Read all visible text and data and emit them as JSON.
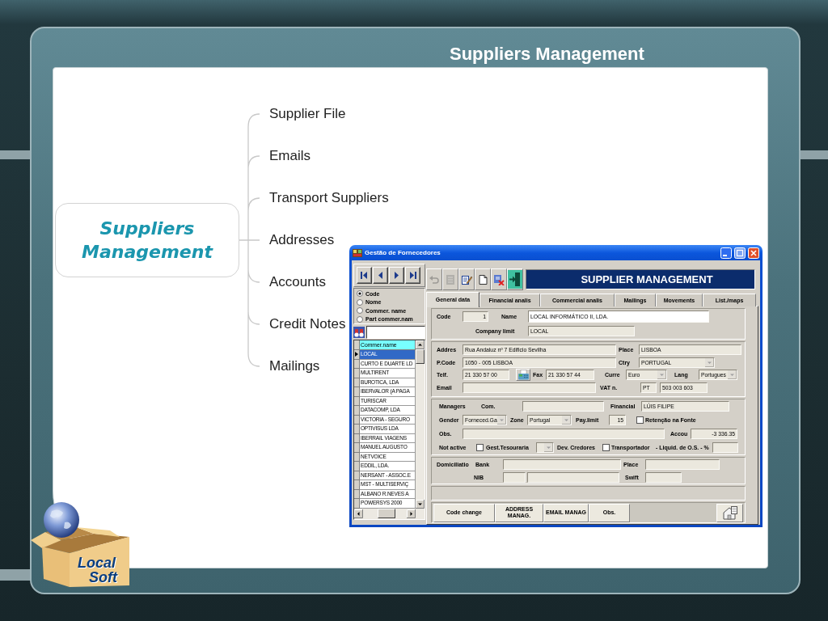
{
  "slide": {
    "title": "Suppliers Management"
  },
  "mind_map": {
    "center": "Suppliers Management",
    "branches": [
      "Supplier File",
      "Emails",
      "Transport Suppliers",
      "Addresses",
      "Accounts",
      "Credit Notes",
      "Mailings"
    ]
  },
  "logo": {
    "lines": [
      "Local",
      "Soft"
    ]
  },
  "window": {
    "title": "Gestão de Fornecedores",
    "search_by": [
      {
        "label": "Code",
        "selected": true
      },
      {
        "label": "Nome",
        "selected": false
      },
      {
        "label": "Commer. name",
        "selected": false
      },
      {
        "label": "Part commer.nam",
        "selected": false
      }
    ],
    "list": {
      "column": "Commer.name",
      "rows": [
        {
          "text": "LOCAL",
          "selected": true
        },
        {
          "text": "CURTO E DUARTE LD",
          "selected": false
        },
        {
          "text": "MULTIRENT",
          "selected": false
        },
        {
          "text": "BUROTICA, LDA",
          "selected": false
        },
        {
          "text": "IBERVALOR (A PAGA",
          "selected": false
        },
        {
          "text": "TURISCAR",
          "selected": false
        },
        {
          "text": "DATACOMP, LDA",
          "selected": false
        },
        {
          "text": "VICTORIA - SEGURO",
          "selected": false
        },
        {
          "text": "OPTIVISUS LDA",
          "selected": false
        },
        {
          "text": "IBERRAIL VIAGENS",
          "selected": false
        },
        {
          "text": "MANUEL AUGUSTO",
          "selected": false
        },
        {
          "text": "NETVOICE",
          "selected": false
        },
        {
          "text": "EDDIL, LDA.",
          "selected": false
        },
        {
          "text": "NERSANT - ASSOC.E",
          "selected": false
        },
        {
          "text": "MST - MULTISERVIÇ",
          "selected": false
        },
        {
          "text": "ALBANO R.NEVES A",
          "selected": false
        },
        {
          "text": "POWERSYS 2000",
          "selected": false
        }
      ]
    },
    "toolbar": [
      {
        "disabled": true
      },
      {
        "disabled": true
      },
      {
        "disabled": false
      },
      {
        "disabled": false
      },
      {
        "disabled": false
      },
      {
        "disabled": false
      }
    ],
    "header": "SUPPLIER MANAGEMENT",
    "tabs": [
      {
        "label": "General data",
        "selected": true
      },
      {
        "label": "Financial analis",
        "selected": false
      },
      {
        "label": "Commercial analis",
        "selected": false
      },
      {
        "label": "Mailings",
        "selected": false
      },
      {
        "label": "Movements",
        "selected": false
      },
      {
        "label": "List./maps",
        "selected": false
      }
    ],
    "form": [
      [
        [
          {
            "kind": "label",
            "text": "Code"
          },
          {
            "kind": "number",
            "value": "1"
          },
          {
            "kind": "label",
            "text": "Name"
          },
          {
            "kind": "input",
            "value": "LOCAL INFORMÁTICO II, LDA."
          }
        ],
        [
          {
            "kind": "label",
            "text": "Company limit"
          },
          {
            "kind": "field",
            "value": "LOCAL"
          }
        ]
      ],
      [
        [
          {
            "kind": "label",
            "text": "Addres"
          },
          {
            "kind": "field",
            "value": "Rua Andaluz nº 7 Edificio Sevilha"
          },
          {
            "kind": "label",
            "text": "Place"
          },
          {
            "kind": "field",
            "value": "LISBOA"
          }
        ],
        [
          {
            "kind": "label",
            "text": "P.Code"
          },
          {
            "kind": "field",
            "value": "1050 - 005 LISBOA"
          },
          {
            "kind": "label",
            "text": "Ctry"
          },
          {
            "kind": "select",
            "value": "PORTUGAL"
          }
        ],
        [
          {
            "kind": "label",
            "text": "Telf."
          },
          {
            "kind": "field",
            "value": "21 330 57 00"
          },
          {
            "kind": "icon_button"
          },
          {
            "kind": "label",
            "text": "Fax"
          },
          {
            "kind": "field",
            "value": "21 330 57 44"
          },
          {
            "kind": "label",
            "text": "Curre"
          },
          {
            "kind": "select",
            "value": "Euro"
          },
          {
            "kind": "label",
            "text": "Lang"
          },
          {
            "kind": "select",
            "value": "Portugues"
          }
        ],
        [
          {
            "kind": "label",
            "text": "Email"
          },
          {
            "kind": "field"
          },
          {
            "kind": "label",
            "text": "VAT n."
          },
          {
            "kind": "field",
            "value": "PT"
          },
          {
            "kind": "field",
            "value": "503 003 603"
          }
        ]
      ],
      [
        [
          {
            "kind": "label",
            "text": "Managers"
          },
          {
            "kind": "label",
            "text": "Com."
          },
          {
            "kind": "field"
          },
          {
            "kind": "label",
            "text": "Financial"
          },
          {
            "kind": "field",
            "value": "LÚIS FILIPE"
          }
        ],
        [
          {
            "kind": "label",
            "text": "Gender"
          },
          {
            "kind": "select",
            "value": "Forneced.Ga"
          },
          {
            "kind": "label",
            "text": "Zone"
          },
          {
            "kind": "select",
            "value": "Portugal"
          },
          {
            "kind": "label",
            "text": "Pay.limit"
          },
          {
            "kind": "number",
            "value": "15"
          },
          {
            "kind": "checkbox",
            "checked": false
          },
          {
            "kind": "label",
            "text": "Retenção na Fonte"
          }
        ],
        [
          {
            "kind": "label",
            "text": "Obs."
          },
          {
            "kind": "field"
          },
          {
            "kind": "label",
            "text": "Accou"
          },
          {
            "kind": "number",
            "value": "-3 336.35"
          }
        ],
        [
          {
            "kind": "label",
            "text": "Not active"
          },
          {
            "kind": "checkbox",
            "checked": false
          },
          {
            "kind": "label",
            "text": "Gest.Tesouraria"
          },
          {
            "kind": "select"
          },
          {
            "kind": "label",
            "text": "Dev. Credores"
          },
          {
            "kind": "checkbox",
            "checked": false
          },
          {
            "kind": "label",
            "text": "Transportador"
          },
          {
            "kind": "label",
            "text": "- Liquid. de O.S. - %"
          },
          {
            "kind": "field"
          }
        ]
      ],
      [
        [
          {
            "kind": "label",
            "text": "Domiciliatio"
          },
          {
            "kind": "label",
            "text": "Bank"
          },
          {
            "kind": "field"
          },
          {
            "kind": "label",
            "text": "Place"
          },
          {
            "kind": "field"
          }
        ],
        [
          {
            "kind": "label",
            "text": "NIB"
          },
          {
            "kind": "field"
          },
          {
            "kind": "field"
          },
          {
            "kind": "label",
            "text": "Swift"
          },
          {
            "kind": "field"
          }
        ]
      ]
    ],
    "buttons": [
      {
        "label": "Code change"
      },
      {
        "label": "ADDRESS MANAG."
      },
      {
        "label": "EMAIL MANAG"
      },
      {
        "label": "Obs."
      }
    ]
  }
}
